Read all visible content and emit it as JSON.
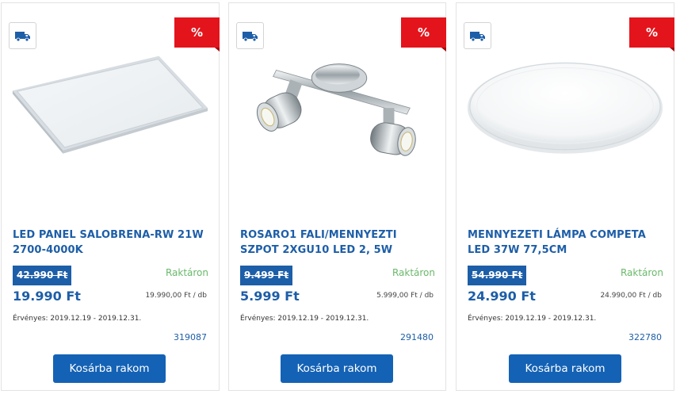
{
  "products": [
    {
      "title": "LED PANEL SALOBRENA-RW 21W 2700-4000K",
      "old_price": "42.990 Ft",
      "stock": "Raktáron",
      "price": "19.990 Ft",
      "unit_price": "19.990,00 Ft / db",
      "valid": "Érvényes: 2019.12.19 - 2019.12.31.",
      "sku": "319087",
      "button": "Kosárba rakom",
      "badge": "%",
      "image_icon": "led-panel-image",
      "delivery_icon": "truck-icon"
    },
    {
      "title": "ROSARO1 FALI/MENNYEZTI SZPOT 2XGU10 LED 2, 5W",
      "old_price": "9.499 Ft",
      "stock": "Raktáron",
      "price": "5.999 Ft",
      "unit_price": "5.999,00 Ft / db",
      "valid": "Érvényes: 2019.12.19 - 2019.12.31.",
      "sku": "291480",
      "button": "Kosárba rakom",
      "badge": "%",
      "image_icon": "spotlight-image",
      "delivery_icon": "truck-icon"
    },
    {
      "title": "MENNYEZETI LÁMPA COMPETA LED 37W 77,5CM",
      "old_price": "54.990 Ft",
      "stock": "Raktáron",
      "price": "24.990 Ft",
      "unit_price": "24.990,00 Ft / db",
      "valid": "Érvényes: 2019.12.19 - 2019.12.31.",
      "sku": "322780",
      "button": "Kosárba rakom",
      "badge": "%",
      "image_icon": "ceiling-lamp-image",
      "delivery_icon": "truck-icon"
    }
  ],
  "colors": {
    "brand_blue": "#1d5ea8",
    "button_blue": "#1462b5",
    "sale_red": "#e4141c",
    "stock_green": "#6bb86b"
  }
}
